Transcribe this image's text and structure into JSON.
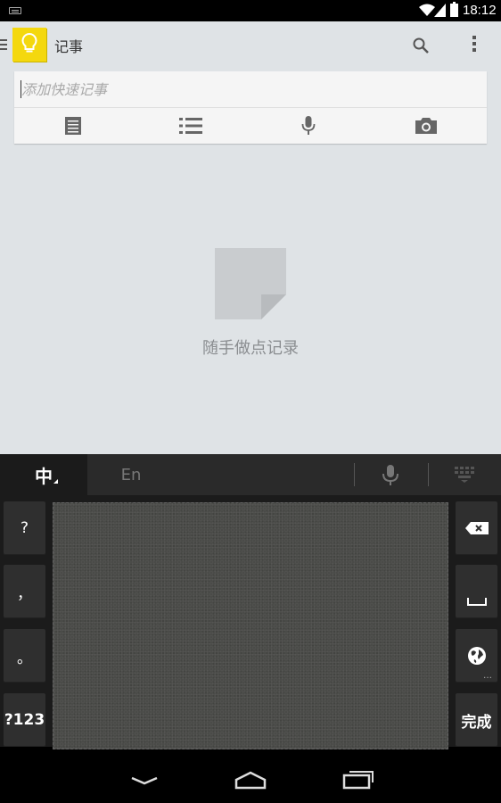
{
  "status_bar": {
    "time": "18:12",
    "icons": [
      "keyboard-icon",
      "wifi-icon",
      "signal-icon",
      "battery-icon"
    ]
  },
  "app": {
    "title": "记事",
    "logo_icon": "lightbulb-icon",
    "accent_color": "#f4d80e",
    "background_color": "#dfe3e6",
    "actions": [
      "search-icon",
      "overflow-menu-icon"
    ],
    "quick_add": {
      "placeholder": "添加快速记事",
      "value": "",
      "buttons": [
        "text-note-icon",
        "list-note-icon",
        "mic-icon",
        "camera-icon"
      ]
    },
    "empty_state": {
      "icon": "note-icon",
      "text": "随手做点记录"
    }
  },
  "keyboard": {
    "tabs": [
      {
        "label": "中",
        "selected": true
      },
      {
        "label": "En",
        "selected": false
      }
    ],
    "top_icons": [
      "mic-icon",
      "keyboard-grid-icon"
    ],
    "left_keys": [
      "?",
      "，",
      "。",
      "?123"
    ],
    "right_keys": [
      {
        "label": "",
        "icon": "backspace-icon"
      },
      {
        "label": "",
        "icon": "space-icon"
      },
      {
        "label": "",
        "icon": "globe-icon",
        "hint": "…"
      },
      {
        "label": "完成",
        "icon": ""
      }
    ],
    "handwriting_pad": "handwriting-area"
  },
  "nav_bar": {
    "buttons": [
      "back-icon",
      "home-icon",
      "recents-icon"
    ]
  }
}
